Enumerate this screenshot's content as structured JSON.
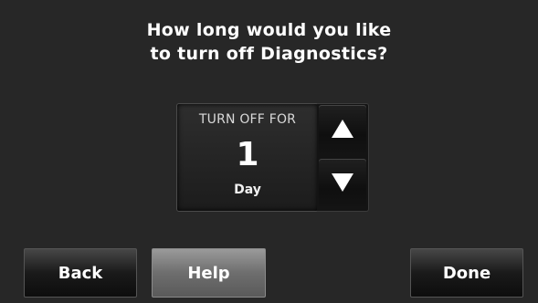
{
  "screen": {
    "title_line1": "How long would you like",
    "title_line2": "to turn off Diagnostics?"
  },
  "duration_panel": {
    "label": "TURN OFF FOR",
    "value": "1",
    "unit": "Day"
  },
  "controls": {
    "up_icon": "triangle-up-icon",
    "down_icon": "triangle-down-icon"
  },
  "footer": {
    "back_label": "Back",
    "help_label": "Help",
    "done_label": "Done"
  },
  "colors": {
    "background": "#272727",
    "text": "#ffffff",
    "help_button": "#7a7a7a"
  }
}
